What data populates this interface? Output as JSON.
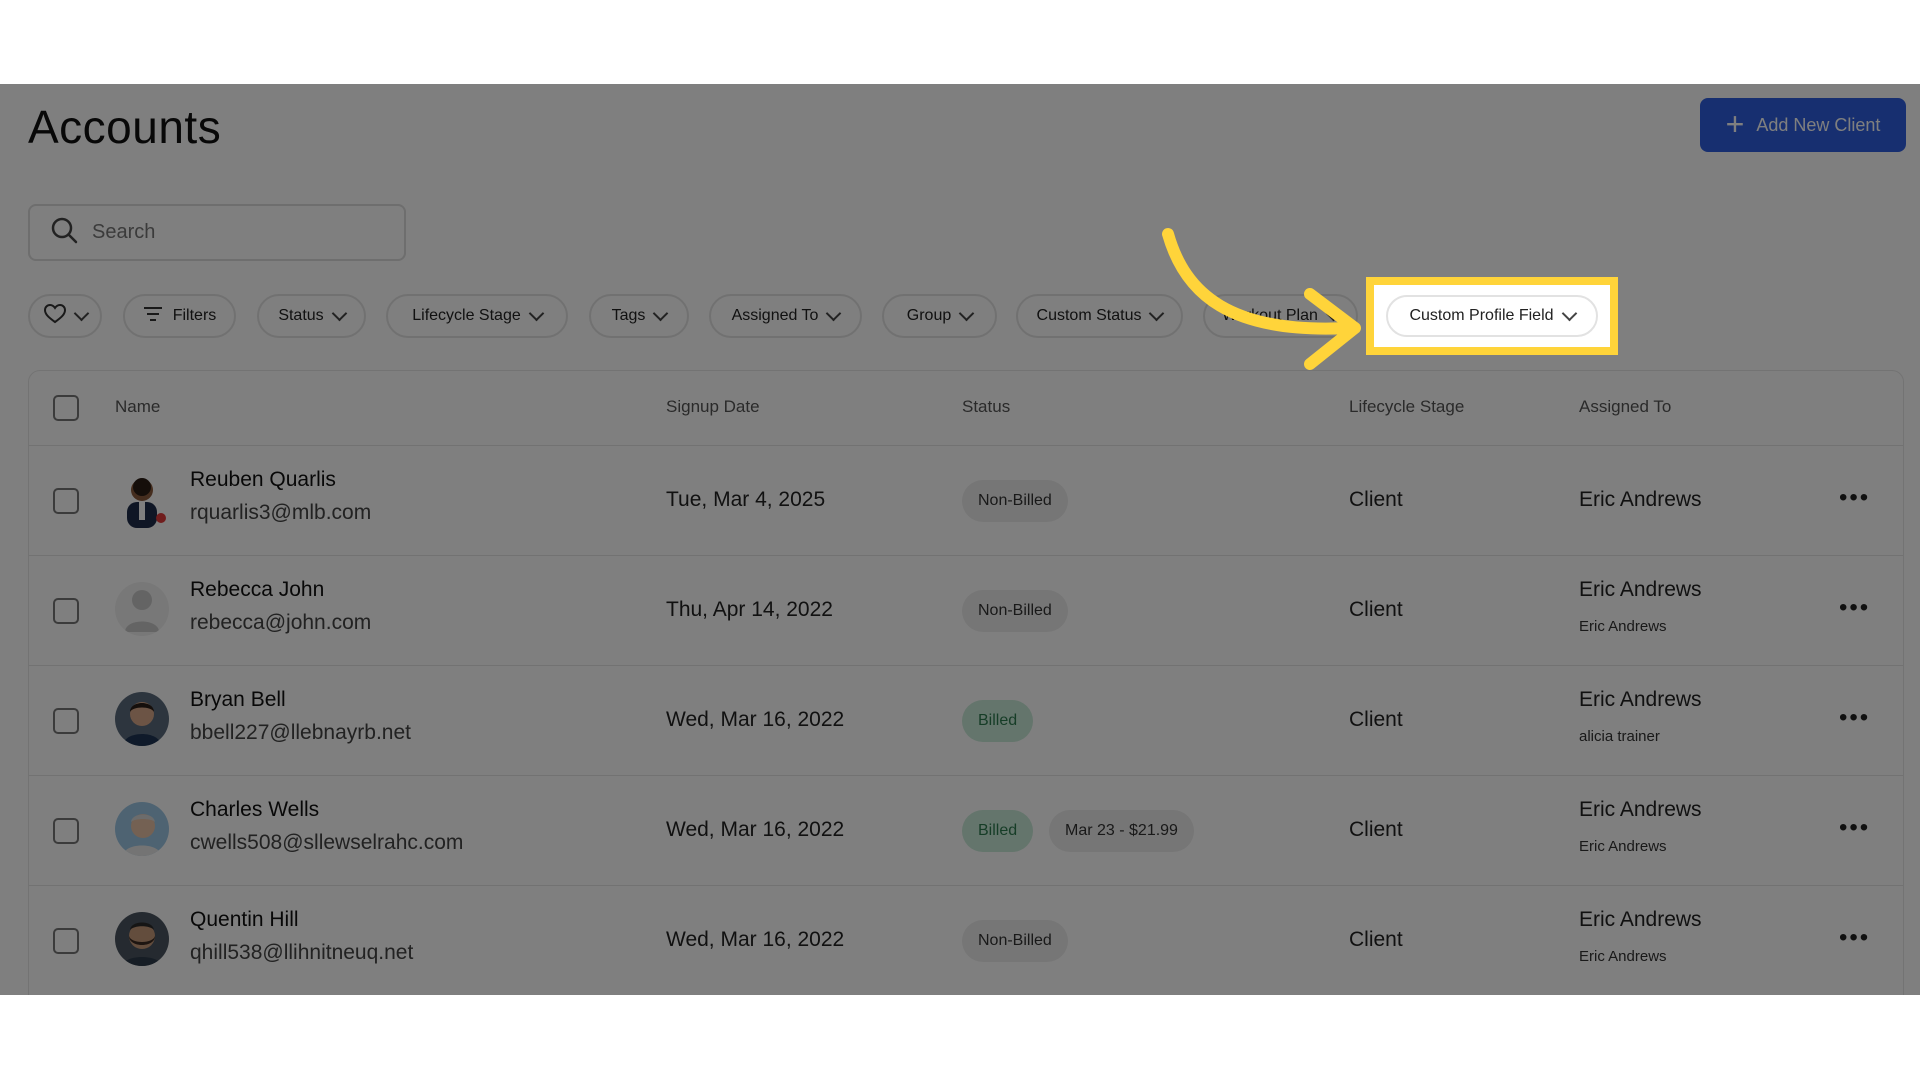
{
  "page": {
    "title": "Accounts",
    "add_button_label": "Add New Client"
  },
  "search": {
    "placeholder": "Search"
  },
  "filters": [
    {
      "label": ""
    },
    {
      "label": "Filters"
    },
    {
      "label": "Status"
    },
    {
      "label": "Lifecycle Stage"
    },
    {
      "label": "Tags"
    },
    {
      "label": "Assigned To"
    },
    {
      "label": "Group"
    },
    {
      "label": "Custom Status"
    },
    {
      "label": "Workout Plan"
    },
    {
      "label": "Custom Profile Field"
    }
  ],
  "table": {
    "headers": [
      "Name",
      "Signup Date",
      "Status",
      "Lifecycle Stage",
      "Assigned To"
    ],
    "rows": [
      {
        "name": "Reuben Quarlis",
        "email": "rquarlis3@mlb.com",
        "signup_date": "Tue, Mar 4, 2025",
        "status": "Non-Billed",
        "payment": "",
        "stage": "Client",
        "assigned_to": "Eric Andrews",
        "trainer": ""
      },
      {
        "name": "Rebecca John",
        "email": "rebecca@john.com",
        "signup_date": "Thu, Apr 14, 2022",
        "status": "Non-Billed",
        "payment": "",
        "stage": "Client",
        "assigned_to": "Eric Andrews",
        "trainer": "Eric Andrews"
      },
      {
        "name": "Bryan Bell",
        "email": "bbell227@llebnayrb.net",
        "signup_date": "Wed, Mar 16, 2022",
        "status": "Billed",
        "payment": "",
        "stage": "Client",
        "assigned_to": "Eric Andrews",
        "trainer": "alicia trainer"
      },
      {
        "name": "Charles Wells",
        "email": "cwells508@sllewselrahc.com",
        "signup_date": "Wed, Mar 16, 2022",
        "status": "Billed",
        "payment": "Mar 23 - $21.99",
        "stage": "Client",
        "assigned_to": "Eric Andrews",
        "trainer": "Eric Andrews"
      },
      {
        "name": "Quentin Hill",
        "email": "qhill538@llihnitneuq.net",
        "signup_date": "Wed, Mar 16, 2022",
        "status": "Non-Billed",
        "payment": "",
        "stage": "Client",
        "assigned_to": "Eric Andrews",
        "trainer": "Eric Andrews"
      }
    ]
  },
  "colors": {
    "accent": "#2f5fe0",
    "highlight": "#ffd43a",
    "billed_bg": "#c8ead8",
    "billed_text": "#2d7a4f"
  },
  "icons": {
    "search": "search-icon",
    "favorite": "heart-icon",
    "filters": "filter-icon",
    "more": "more-options-icon",
    "add": "plus-icon"
  }
}
